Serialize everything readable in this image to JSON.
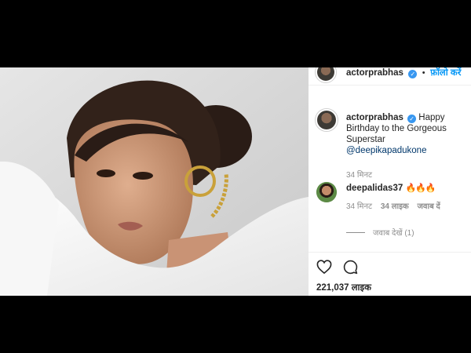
{
  "post": {
    "author": "actorprabhas",
    "follow_label": "फ़ॉलो करें",
    "separator": "•",
    "verified_glyph": "✓"
  },
  "caption": {
    "username": "actorprabhas",
    "text": "Happy Birthday to the Gorgeous Superstar",
    "mention": "@deepikapadukone",
    "time": "34 मिनट"
  },
  "comment": {
    "username": "deepalidas37",
    "text": "🔥🔥🔥",
    "time": "34 मिनट",
    "likes": "34 लाइक",
    "reply_label": "जवाब दें"
  },
  "view_replies": "जवाब देखें (1)",
  "likes_count": "221,037 लाइक",
  "icons": [
    "heart-icon",
    "comment-icon",
    "verified-badge-icon"
  ],
  "colors": {
    "link_blue": "#0095f6",
    "mention": "#00376b",
    "verified": "#3897f0",
    "meta_gray": "#8e8e8e"
  }
}
